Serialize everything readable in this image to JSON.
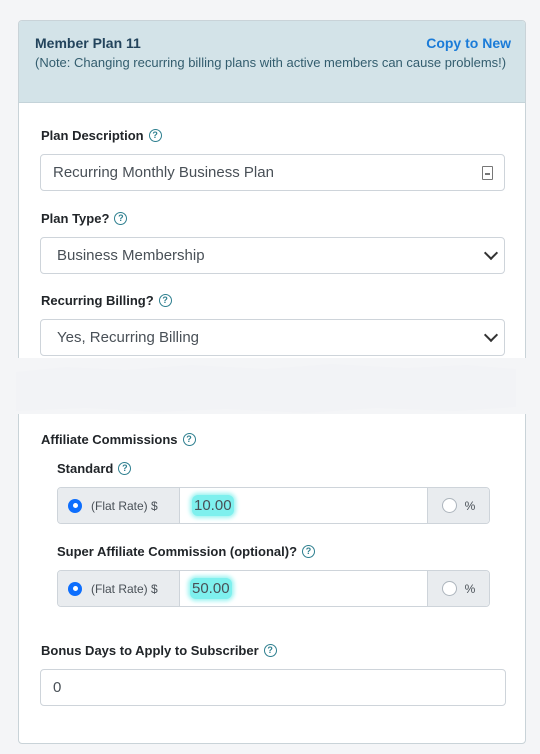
{
  "card": {
    "title": "Member Plan 11",
    "copy_link": "Copy to New",
    "note": "(Note: Changing recurring billing plans with active members can cause problems!)"
  },
  "plan_description": {
    "label": "Plan Description",
    "value": "Recurring Monthly Business Plan"
  },
  "plan_type": {
    "label": "Plan Type?",
    "selected": "Business Membership"
  },
  "recurring_billing": {
    "label": "Recurring Billing?",
    "selected": "Yes, Recurring Billing"
  },
  "affiliate": {
    "label": "Affiliate Commissions",
    "standard": {
      "label": "Standard",
      "prepend": "(Flat Rate) $",
      "value": "10.00",
      "append": "%"
    },
    "super": {
      "label": "Super Affiliate Commission (optional)?",
      "prepend": "(Flat Rate) $",
      "value": "50.00",
      "append": "%"
    }
  },
  "bonus_days": {
    "label": "Bonus Days to Apply to Subscriber",
    "value": "0"
  },
  "help_glyph": "?",
  "colors": {
    "header_bg": "#d3e3e8",
    "link": "#1a7bd8",
    "radio_active": "#0d6efd",
    "highlight": "#7ef0ee"
  }
}
